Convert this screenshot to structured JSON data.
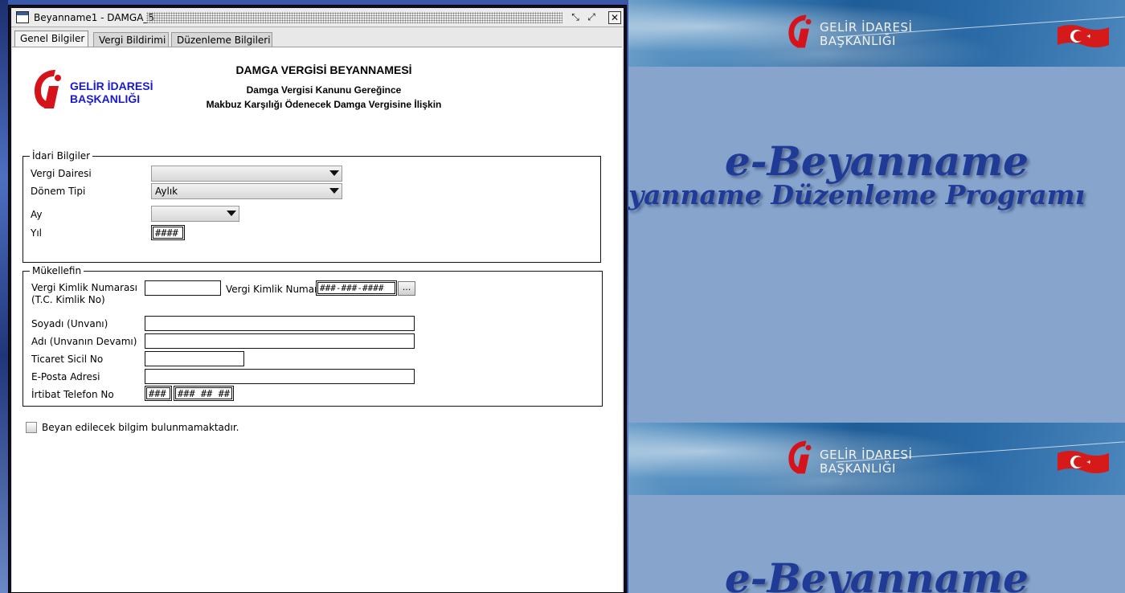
{
  "window": {
    "title": "Beyanname1 - DAMGA_5",
    "controls": {
      "minimize": "⤡",
      "maximize": "⤢",
      "close": "✕"
    }
  },
  "tabs": [
    {
      "label": "Genel Bilgiler",
      "active": true
    },
    {
      "label": "Vergi Bildirimi",
      "active": false
    },
    {
      "label": "Düzenleme Bilgileri",
      "active": false
    }
  ],
  "header": {
    "logo_line1": "GELİR İDARESİ",
    "logo_line2": "BAŞKANLIĞI",
    "title": "DAMGA VERGİSİ BEYANNAMESİ",
    "subtitle1": "Damga Vergisi Kanunu Gereğince",
    "subtitle2": "Makbuz Karşılığı Ödenecek Damga Vergisine İlişkin"
  },
  "idari": {
    "legend": "İdari Bilgiler",
    "vergi_dairesi": {
      "label": "Vergi Dairesi",
      "value": ""
    },
    "donem_tipi": {
      "label": "Dönem Tipi",
      "value": "Aylık"
    },
    "ay": {
      "label": "Ay",
      "value": ""
    },
    "yil": {
      "label": "Yıl",
      "value": "####"
    }
  },
  "mukellefin": {
    "legend": "Mükellefin",
    "vkn_label_line1": "Vergi Kimlik Numarası",
    "vkn_label_line2": "(T.C. Kimlik No)",
    "vkn_value": "",
    "vkn2_label": "Vergi Kimlik Numar...",
    "vkn2_value": "###-###-####",
    "browse_label": "...",
    "soyadi_label": "Soyadı (Unvanı)",
    "adi_label": "Adı (Unvanın Devamı)",
    "ticaret_label": "Ticaret Sicil No",
    "eposta_label": "E-Posta Adresi",
    "telefon_label": "İrtibat Telefon No",
    "telefon_code": "###",
    "telefon_number": "### ## ##"
  },
  "checkbox_label": "Beyan edilecek bilgim bulunmamaktadır.",
  "desktop": {
    "banner_text_line1": "GELİR İDARESİ",
    "banner_text_line2": "BAŞKANLIĞI",
    "ebeyanname_title": "e-Beyanname",
    "ebeyanname_subtitle": "yanname Düzenleme Programı"
  },
  "colors": {
    "logo_red": "#d6121a",
    "logo_blue": "#1a1acc",
    "ebey_blue": "#1f3b96",
    "panel_bg": "#86a4cc"
  }
}
